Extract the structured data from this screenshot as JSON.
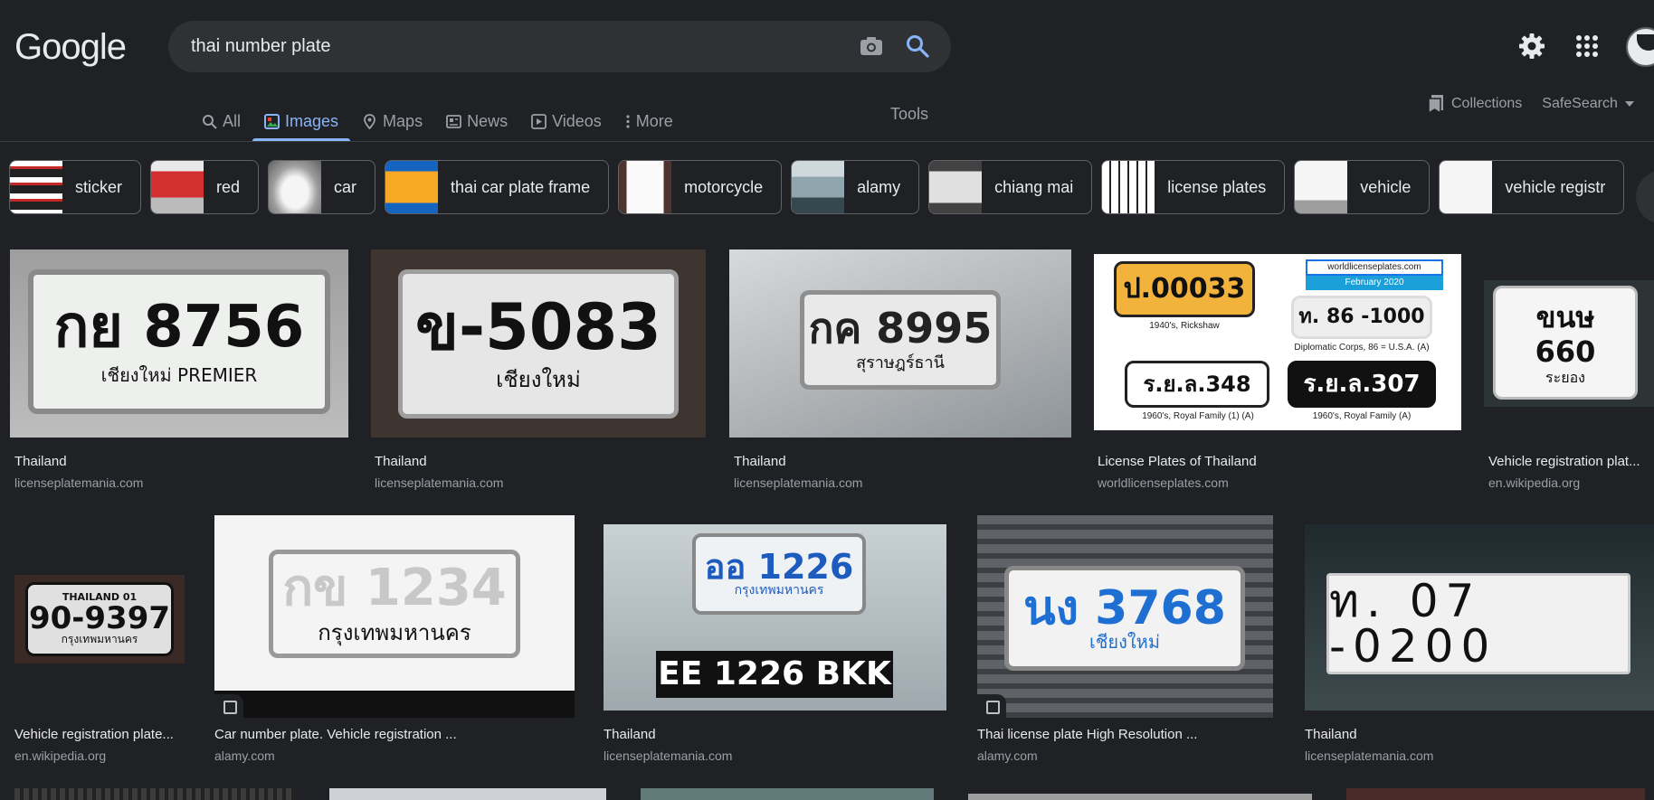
{
  "header": {
    "logo": "Google",
    "search_value": "thai number plate",
    "icons": [
      "camera-icon",
      "search-icon",
      "settings-gear-icon",
      "apps-grid-icon",
      "avatar"
    ]
  },
  "tabs": [
    {
      "label": "All",
      "icon": "search-icon"
    },
    {
      "label": "Images",
      "icon": "images-icon"
    },
    {
      "label": "Maps",
      "icon": "map-pin-icon"
    },
    {
      "label": "News",
      "icon": "news-icon"
    },
    {
      "label": "Videos",
      "icon": "video-icon"
    },
    {
      "label": "More",
      "icon": "more-vert-icon"
    }
  ],
  "tools_label": "Tools",
  "collections_label": "Collections",
  "safesearch_label": "SafeSearch",
  "chips": [
    {
      "label": "sticker"
    },
    {
      "label": "red"
    },
    {
      "label": "car"
    },
    {
      "label": "thai car plate frame"
    },
    {
      "label": "motorcycle"
    },
    {
      "label": "alamy"
    },
    {
      "label": "chiang mai"
    },
    {
      "label": "license plates"
    },
    {
      "label": "vehicle"
    },
    {
      "label": "vehicle registr"
    }
  ],
  "results": [
    {
      "title": "Thailand",
      "source": "licenseplatemania.com",
      "plate": "กย 8756",
      "plate_sub": "เชียงใหม่ PREMIER"
    },
    {
      "title": "Thailand",
      "source": "licenseplatemania.com",
      "plate": "ข-5083",
      "plate_sub": "เชียงใหม่"
    },
    {
      "title": "Thailand",
      "source": "licenseplatemania.com",
      "plate": "กค 8995",
      "plate_sub": "สุราษฎร์ธานี"
    },
    {
      "title": "License Plates of Thailand",
      "source": "worldlicenseplates.com",
      "plate": "ร.ย.ล.307",
      "plate_sub": "1960's, Royal Family (1) (A)"
    },
    {
      "title": "Vehicle registration plat...",
      "source": "en.wikipedia.org",
      "plate": "ขนษ 660",
      "plate_sub": "ระยอง"
    },
    {
      "title": "Vehicle registration plate...",
      "source": "en.wikipedia.org",
      "plate": "90-9397",
      "plate_sub": "กรุงเทพมหานคร"
    },
    {
      "title": "Car number plate. Vehicle registration ...",
      "source": "alamy.com",
      "plate": "กข 1234",
      "plate_sub": "กรุงเทพมหานคร"
    },
    {
      "title": "Thailand",
      "source": "licenseplatemania.com",
      "plate": "ออ 1226",
      "plate_sub": "กรุงเทพมหานคร"
    },
    {
      "title": "Thai license plate High Resolution ...",
      "source": "alamy.com",
      "plate": "นง 3768",
      "plate_sub": "เชียงใหม่"
    },
    {
      "title": "Thailand",
      "source": "licenseplatemania.com",
      "plate": "ท. 07 -0200",
      "plate_sub": ""
    }
  ],
  "worldplates_extra": {
    "banner_line1": "worldlicenseplates.com",
    "banner_line2": "February 2020",
    "plate_a": "ป.00033",
    "plate_a_caption": "1940's, Rickshaw",
    "plate_b": "ท. 86 -1000",
    "plate_b_caption": "Diplomatic Corps, 86 = U.S.A. (A)",
    "plate_c": "ร.ย.ล.348",
    "plate_c_caption": "1960's, Royal Family (1) (A)",
    "plate_d": "ร.ย.ล.307",
    "plate_d_caption": "1960's, Royal Family (A)"
  },
  "bkk_plate": "EE 1226 BKK",
  "thailand01": "THAILAND 01",
  "colors": {
    "accent": "#8ab4f8",
    "background": "#202124",
    "surface": "#303134"
  }
}
